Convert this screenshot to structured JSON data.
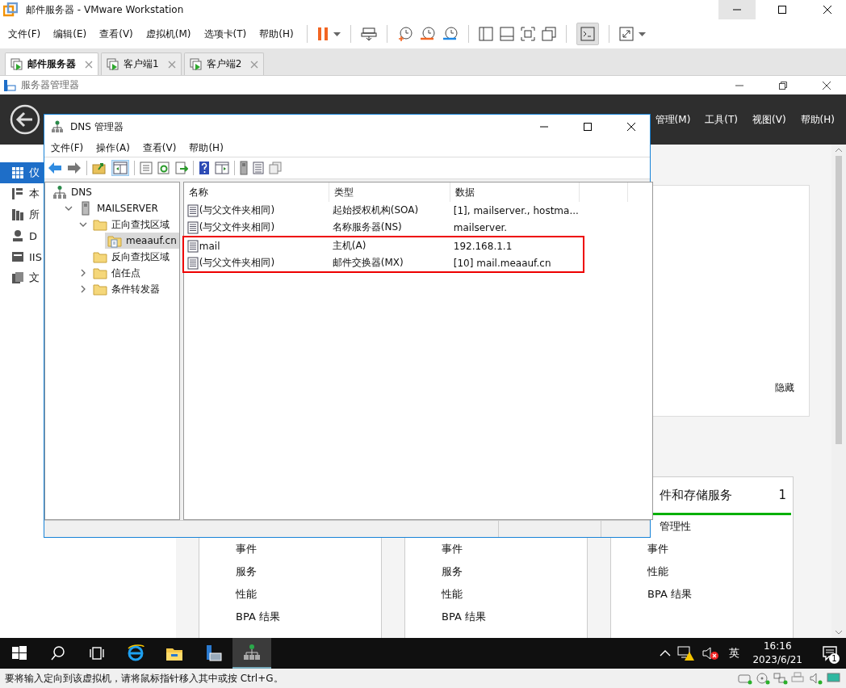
{
  "vm": {
    "title": "邮件服务器 - VMware Workstation",
    "menu": [
      "文件(F)",
      "编辑(E)",
      "查看(V)",
      "虚拟机(M)",
      "选项卡(T)",
      "帮助(H)"
    ],
    "tabs": [
      {
        "label": "邮件服务器",
        "selected": true
      },
      {
        "label": "客户端1",
        "selected": false
      },
      {
        "label": "客户端2",
        "selected": false
      }
    ]
  },
  "server_manager": {
    "title": "服务器管理器",
    "header_menu": [
      "管理(M)",
      "工具(T)",
      "视图(V)",
      "帮助(H)"
    ],
    "sidebar": [
      {
        "label": "仪",
        "kind": "dashboard",
        "selected": true
      },
      {
        "label": "本",
        "kind": "server",
        "selected": false
      },
      {
        "label": "所",
        "kind": "servers",
        "selected": false
      },
      {
        "label": "D",
        "kind": "dns",
        "selected": false
      },
      {
        "label": "IIS",
        "kind": "iis",
        "selected": false
      },
      {
        "label": "文",
        "kind": "files",
        "selected": false
      }
    ],
    "panel_link": "隐藏",
    "tiles": [
      {
        "items": [
          "事件",
          "服务",
          "性能",
          "BPA 结果"
        ]
      },
      {
        "items": [
          "事件",
          "服务",
          "性能",
          "BPA 结果"
        ]
      },
      {
        "title": "件和存储服务",
        "count": "1",
        "items": [
          "管理性",
          "事件",
          "性能",
          "BPA 结果"
        ]
      }
    ]
  },
  "dns": {
    "title": "DNS 管理器",
    "menu": [
      "文件(F)",
      "操作(A)",
      "查看(V)",
      "帮助(H)"
    ],
    "tree": [
      {
        "label": "DNS",
        "kind": "dns",
        "selected": false,
        "children": [
          {
            "label": "MAILSERVER",
            "kind": "server",
            "expanded": true,
            "selected": false,
            "children": [
              {
                "label": "正向查找区域",
                "kind": "folder",
                "expanded": true,
                "selected": false,
                "children": [
                  {
                    "label": "meaauf.cn",
                    "kind": "zone",
                    "selected": true
                  }
                ]
              },
              {
                "label": "反向查找区域",
                "kind": "folder",
                "selected": false
              },
              {
                "label": "信任点",
                "kind": "folder",
                "expanded": false,
                "selected": false
              },
              {
                "label": "条件转发器",
                "kind": "folder",
                "expanded": false,
                "selected": false
              }
            ]
          }
        ]
      }
    ],
    "columns": [
      "名称",
      "类型",
      "数据"
    ],
    "rows": [
      {
        "name": "(与父文件夹相同)",
        "type": "起始授权机构(SOA)",
        "data": "[1], mailserver., hostma...",
        "highlighted": false
      },
      {
        "name": "(与父文件夹相同)",
        "type": "名称服务器(NS)",
        "data": "mailserver.",
        "highlighted": false
      },
      {
        "name": "mail",
        "type": "主机(A)",
        "data": "192.168.1.1",
        "highlighted": true
      },
      {
        "name": "(与父文件夹相同)",
        "type": "邮件交换器(MX)",
        "data": "[10]  mail.meaauf.cn",
        "highlighted": true
      }
    ]
  },
  "taskbar": {
    "apps": [
      {
        "kind": "start",
        "selected": false
      },
      {
        "kind": "search",
        "selected": false
      },
      {
        "kind": "taskview",
        "selected": false
      },
      {
        "kind": "browser",
        "selected": false
      },
      {
        "kind": "explorer",
        "selected": false
      },
      {
        "kind": "servermanager",
        "selected": false
      },
      {
        "kind": "dns",
        "selected": true
      }
    ],
    "ime": "英",
    "time": "16:16",
    "date": "2023/6/21",
    "notifications": "1"
  },
  "status_bar": "要将输入定向到该虚拟机，请将鼠标指针移入其中或按 Ctrl+G。"
}
